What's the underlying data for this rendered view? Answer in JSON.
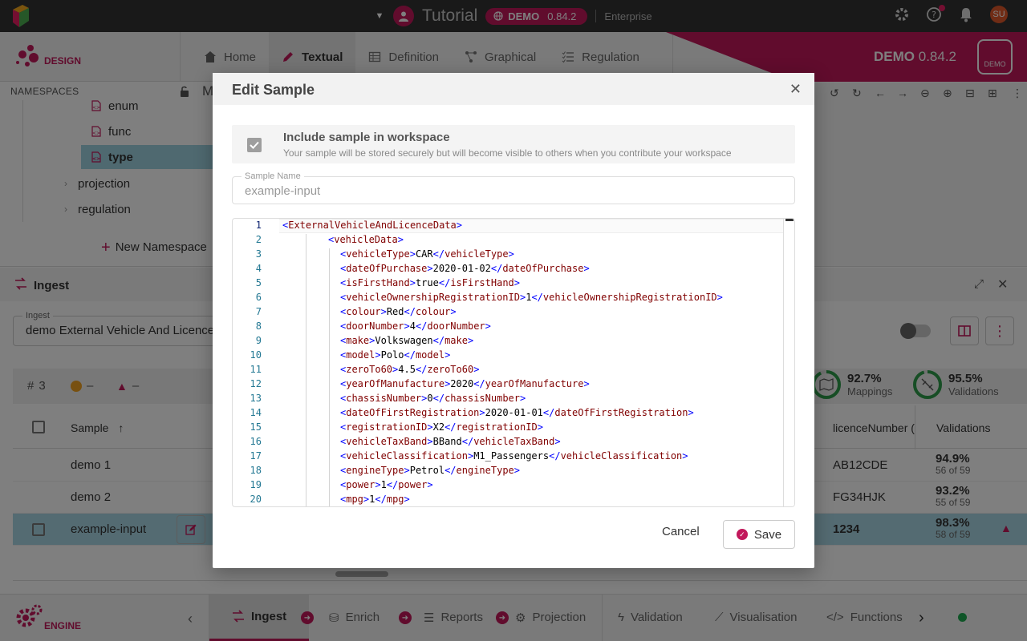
{
  "topbar": {
    "title": "Tutorial",
    "demo_label": "DEMO",
    "demo_version": "0.84.2",
    "edition": "Enterprise",
    "user_initials": "SU"
  },
  "design": {
    "label": "DESIGN",
    "tabs": [
      {
        "label": "Home",
        "icon": "home-icon"
      },
      {
        "label": "Textual",
        "icon": "pencil-icon"
      },
      {
        "label": "Definition",
        "icon": "table-icon"
      },
      {
        "label": "Graphical",
        "icon": "graph-icon"
      },
      {
        "label": "Regulation",
        "icon": "list-check-icon"
      }
    ],
    "banner_label": "DEMO",
    "banner_version": "0.84.2",
    "badge": "DEMO"
  },
  "namespaces": {
    "header": "NAMESPACES",
    "partial_label": "M",
    "files": [
      "enum",
      "func",
      "type"
    ],
    "folders": [
      "projection",
      "regulation"
    ],
    "new_label": "New Namespace"
  },
  "ingest": {
    "title": "Ingest",
    "select_label": "Ingest",
    "select_value": "demo External Vehicle And Licence",
    "count": "3",
    "warn_count": "–",
    "error_count": "–",
    "mappings_pct": "92.7%",
    "mappings_label": "Mappings",
    "validations_pct": "95.5%",
    "validations_label": "Validations",
    "col_sample": "Sample",
    "col_licence": "licenceNumber (",
    "col_validations": "Validations",
    "rows": [
      {
        "sample": "demo 1",
        "licence": "AB12CDE",
        "pct": "94.9%",
        "sub": "56 of 59"
      },
      {
        "sample": "demo 2",
        "licence": "FG34HJK",
        "pct": "93.2%",
        "sub": "55 of 59"
      },
      {
        "sample": "example-input",
        "licence": "1234",
        "pct": "98.3%",
        "sub": "58 of 59"
      }
    ]
  },
  "engine": {
    "label": "ENGINE",
    "tabs": [
      "Ingest",
      "Enrich",
      "Reports",
      "Projection",
      "Validation",
      "Visualisation",
      "Functions"
    ]
  },
  "modal": {
    "title": "Edit Sample",
    "include_title": "Include sample in workspace",
    "include_sub": "Your sample will be stored securely but will become visible to others when you contribute your workspace",
    "name_label": "Sample Name",
    "name_value": "example-input",
    "cancel": "Cancel",
    "save": "Save",
    "code": [
      {
        "n": "1",
        "indent": 0,
        "tag": "ExternalVehicleAndLicenceData",
        "text": null
      },
      {
        "n": "2",
        "indent": 1,
        "tag": "vehicleData",
        "text": null
      },
      {
        "n": "3",
        "indent": 2,
        "tag": "vehicleType",
        "text": "CAR"
      },
      {
        "n": "4",
        "indent": 2,
        "tag": "dateOfPurchase",
        "text": "2020-01-02"
      },
      {
        "n": "5",
        "indent": 2,
        "tag": "isFirstHand",
        "text": "true"
      },
      {
        "n": "6",
        "indent": 2,
        "tag": "vehicleOwnershipRegistrationID",
        "text": "1"
      },
      {
        "n": "7",
        "indent": 2,
        "tag": "colour",
        "text": "Red"
      },
      {
        "n": "8",
        "indent": 2,
        "tag": "doorNumber",
        "text": "4"
      },
      {
        "n": "9",
        "indent": 2,
        "tag": "make",
        "text": "Volkswagen"
      },
      {
        "n": "10",
        "indent": 2,
        "tag": "model",
        "text": "Polo"
      },
      {
        "n": "11",
        "indent": 2,
        "tag": "zeroTo60",
        "text": "4.5"
      },
      {
        "n": "12",
        "indent": 2,
        "tag": "yearOfManufacture",
        "text": "2020"
      },
      {
        "n": "13",
        "indent": 2,
        "tag": "chassisNumber",
        "text": "0"
      },
      {
        "n": "14",
        "indent": 2,
        "tag": "dateOfFirstRegistration",
        "text": "2020-01-01"
      },
      {
        "n": "15",
        "indent": 2,
        "tag": "registrationID",
        "text": "X2"
      },
      {
        "n": "16",
        "indent": 2,
        "tag": "vehicleTaxBand",
        "text": "BBand"
      },
      {
        "n": "17",
        "indent": 2,
        "tag": "vehicleClassification",
        "text": "M1_Passengers"
      },
      {
        "n": "18",
        "indent": 2,
        "tag": "engineType",
        "text": "Petrol"
      },
      {
        "n": "19",
        "indent": 2,
        "tag": "power",
        "text": "1"
      },
      {
        "n": "20",
        "indent": 2,
        "tag": "mpg",
        "text": "1"
      }
    ]
  },
  "colors": {
    "brand": "#c2185b",
    "topbar": "#323232",
    "selection": "#a9d6e4"
  }
}
